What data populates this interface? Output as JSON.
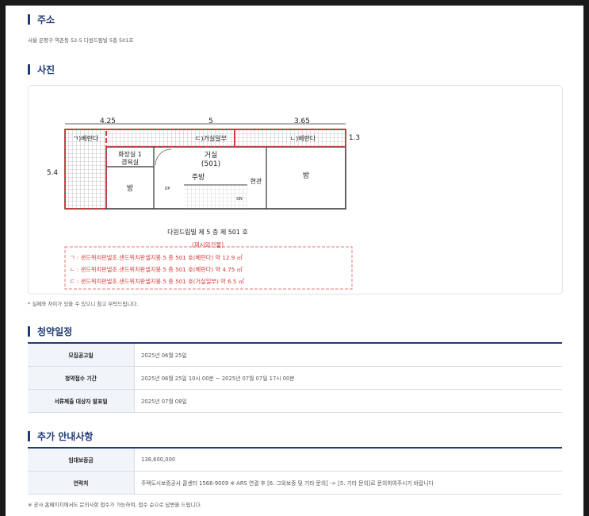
{
  "sections": {
    "address": {
      "title": "주소",
      "value": "서울 은평구 역촌동 52-5 다원드림빌 5층 501호"
    },
    "photo": {
      "title": "사진",
      "note": "* 실제와 차이가 있을 수 있으니 참고 부탁드립니다.",
      "plan": {
        "dims": {
          "d1": "4.25",
          "d2": "5",
          "d3": "3.65",
          "d4": "1.3",
          "d5": "5.4"
        },
        "rooms": {
          "veranda1": "ㄱ)베란다",
          "living_part": "ㄷ)거실일부",
          "veranda2": "ㄴ)베란다",
          "bathroom1": "화장실 1",
          "bathroom2": "겸욕실",
          "living": "거실",
          "unit": "(501)",
          "kitchen": "주방",
          "room1": "방",
          "room2": "방",
          "entrance": "현관",
          "up": "UP",
          "dn": "DN"
        },
        "caption": "다원드림빌 제 5 층 제 501 호",
        "legend": {
          "title": "(제시외건물)",
          "rows": [
            "ㄱ : 샌드위치판넬조.샌드위치판넬지붕.5 층 501 호(베란다) 약 12.9 ㎡",
            "ㄴ : 샌드위치판넬조.샌드위치판넬지붕.5 층 501 호(베란다) 약 4.75 ㎡",
            "ㄷ : 샌드위치판넬조.샌드위치판넬지붕.5 층 501 호(거실일부) 약 6.5 ㎡"
          ]
        }
      }
    },
    "schedule": {
      "title": "청약일정",
      "rows": [
        {
          "label": "모집공고일",
          "value": "2025년 06월 25일"
        },
        {
          "label": "청약접수 기간",
          "value": "2025년 06월 25일 10시 00분 ~ 2025년 07월 07일 17시 00분"
        },
        {
          "label": "서류제출 대상자 발표일",
          "value": "2025년 07월 08일"
        }
      ]
    },
    "extra": {
      "title": "추가 안내사항",
      "rows": [
        {
          "label": "임대보증금",
          "value": "138,600,000"
        },
        {
          "label": "연락처",
          "value": "주택도시보증공사 콜센터 1566-9009 ※ ARS 연결 후 [6. 그외보증 및 기타 문의] -> [5. 기타 문의]로 문의하여주시기 바랍니다"
        }
      ],
      "note": "※ 공사 홈페이지에서도 문의사항 접수가 가능하며, 접수 순으로 답변을 드립니다."
    }
  },
  "colors": {
    "accent": "#1f3b73",
    "dashed_red": "#d63a3a",
    "table_header_bg": "#f1f4f9"
  }
}
